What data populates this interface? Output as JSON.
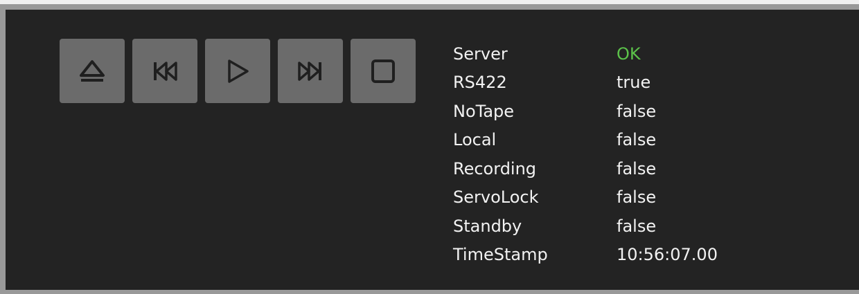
{
  "transport": {
    "buttons": [
      {
        "icon": "eject-icon"
      },
      {
        "icon": "previous-icon"
      },
      {
        "icon": "play-icon"
      },
      {
        "icon": "next-icon"
      },
      {
        "icon": "stop-icon"
      }
    ]
  },
  "status": {
    "rows": [
      {
        "label": "Server",
        "value": "OK",
        "value_color": "#5cc24a"
      },
      {
        "label": "RS422",
        "value": "true"
      },
      {
        "label": "NoTape",
        "value": "false"
      },
      {
        "label": "Local",
        "value": "false"
      },
      {
        "label": "Recording",
        "value": "false"
      },
      {
        "label": "ServoLock",
        "value": "false"
      },
      {
        "label": "Standby",
        "value": "false"
      },
      {
        "label": "TimeStamp",
        "value": "10:56:07.00"
      }
    ]
  },
  "colors": {
    "panel_bg": "#232323",
    "button_bg": "#6b6b6b",
    "icon": "#1f1f1f",
    "ok": "#5cc24a"
  }
}
